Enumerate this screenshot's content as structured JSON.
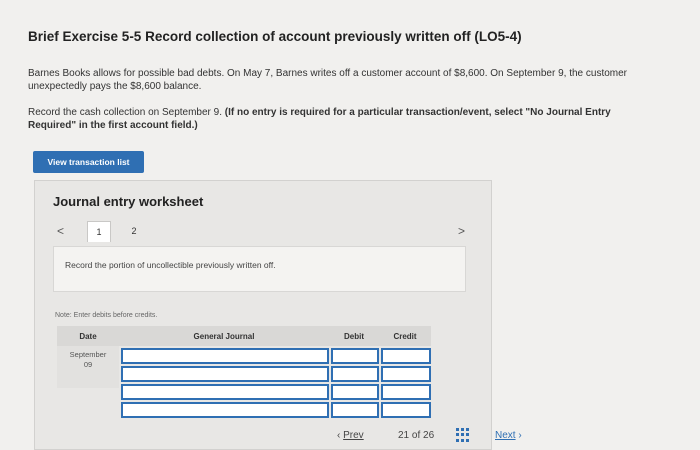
{
  "header": {
    "title": "Brief Exercise 5-5 Record collection of account previously written off (LO5-4)"
  },
  "problem": {
    "paragraph1": "Barnes Books allows for possible bad debts. On May 7, Barnes writes off a customer account of $8,600. On September 9, the customer unexpectedly pays the $8,600 balance.",
    "paragraph2_prefix": "Record the cash collection on September 9. ",
    "paragraph2_instruction": "(If no entry is required for a particular transaction/event, select \"No Journal Entry Required\" in the first account field.)"
  },
  "buttons": {
    "view_transaction_list": "View transaction list"
  },
  "worksheet": {
    "title": "Journal entry worksheet",
    "prev_icon": "<",
    "next_icon": ">",
    "tabs": [
      "1",
      "2"
    ],
    "active_tab": 0,
    "entry_instruction": "Record the portion of uncollectible previously written off.",
    "note": "Note: Enter debits before credits.",
    "table": {
      "headers": {
        "date": "Date",
        "general_journal": "General Journal",
        "debit": "Debit",
        "credit": "Credit"
      },
      "date_value_line1": "September",
      "date_value_line2": "09"
    }
  },
  "footer": {
    "prev_label": "Prev",
    "page_current": "21",
    "page_of": "of",
    "page_total": "26",
    "next_label": "Next",
    "accent": "#2f6fb3"
  }
}
